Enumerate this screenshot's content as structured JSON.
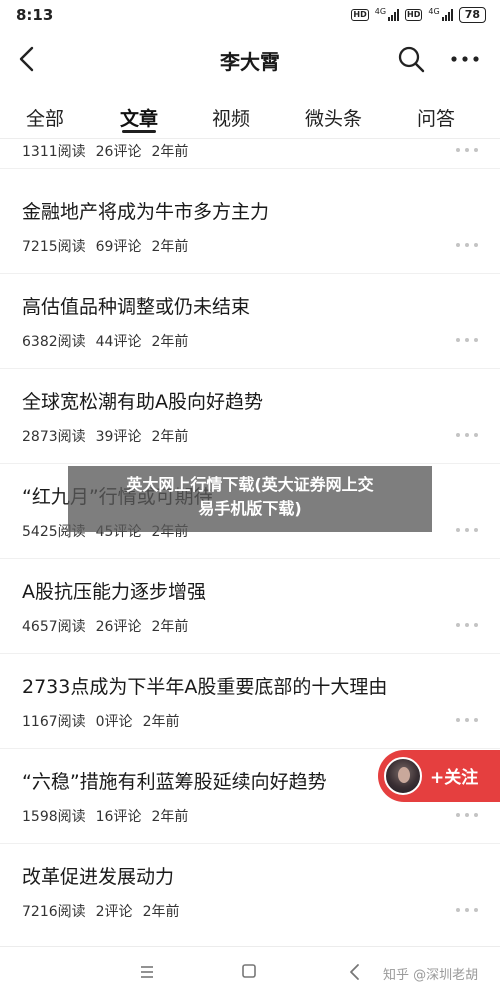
{
  "status_bar": {
    "time": "8:13",
    "hd1": "HD",
    "net1": "4G",
    "hd2": "HD",
    "net2": "4G",
    "battery": "78"
  },
  "header": {
    "title": "李大霄",
    "back_icon": "back-arrow-icon",
    "search_icon": "search-icon",
    "more_icon": "more-dots-icon"
  },
  "tabs": [
    {
      "label": "全部"
    },
    {
      "label": "文章"
    },
    {
      "label": "视频"
    },
    {
      "label": "微头条"
    },
    {
      "label": "问答"
    }
  ],
  "active_tab": "文章",
  "articles": [
    {
      "title": "",
      "reads": "1311阅读",
      "comments": "26评论",
      "time": "2年前"
    },
    {
      "title": "金融地产将成为牛市多方主力",
      "reads": "7215阅读",
      "comments": "69评论",
      "time": "2年前"
    },
    {
      "title": "高估值品种调整或仍未结束",
      "reads": "6382阅读",
      "comments": "44评论",
      "time": "2年前"
    },
    {
      "title": "全球宽松潮有助A股向好趋势",
      "reads": "2873阅读",
      "comments": "39评论",
      "time": "2年前"
    },
    {
      "title": "“红九月”行情或可期待",
      "reads": "5425阅读",
      "comments": "45评论",
      "time": "2年前"
    },
    {
      "title": "A股抗压能力逐步增强",
      "reads": "4657阅读",
      "comments": "26评论",
      "time": "2年前"
    },
    {
      "title": "2733点成为下半年A股重要底部的十大理由",
      "reads": "1167阅读",
      "comments": "0评论",
      "time": "2年前"
    },
    {
      "title": "“六稳”措施有利蓝筹股延续向好趋势",
      "reads": "1598阅读",
      "comments": "16评论",
      "time": "2年前"
    },
    {
      "title": "改革促进发展动力",
      "reads": "7216阅读",
      "comments": "2评论",
      "time": "2年前"
    }
  ],
  "overlay": {
    "line1": "英大网上行情下载(英大证券网上交",
    "line2": "易手机版下载)"
  },
  "follow_button": {
    "label": "+关注"
  },
  "nav_bar": {
    "menu_icon": "menu-icon",
    "home_icon": "home-square-icon",
    "back_icon": "back-triangle-icon",
    "watermark": "知乎 @深圳老胡"
  },
  "colors": {
    "accent_red": "#e53f3f",
    "overlay_gray": "#5a5a5a"
  }
}
